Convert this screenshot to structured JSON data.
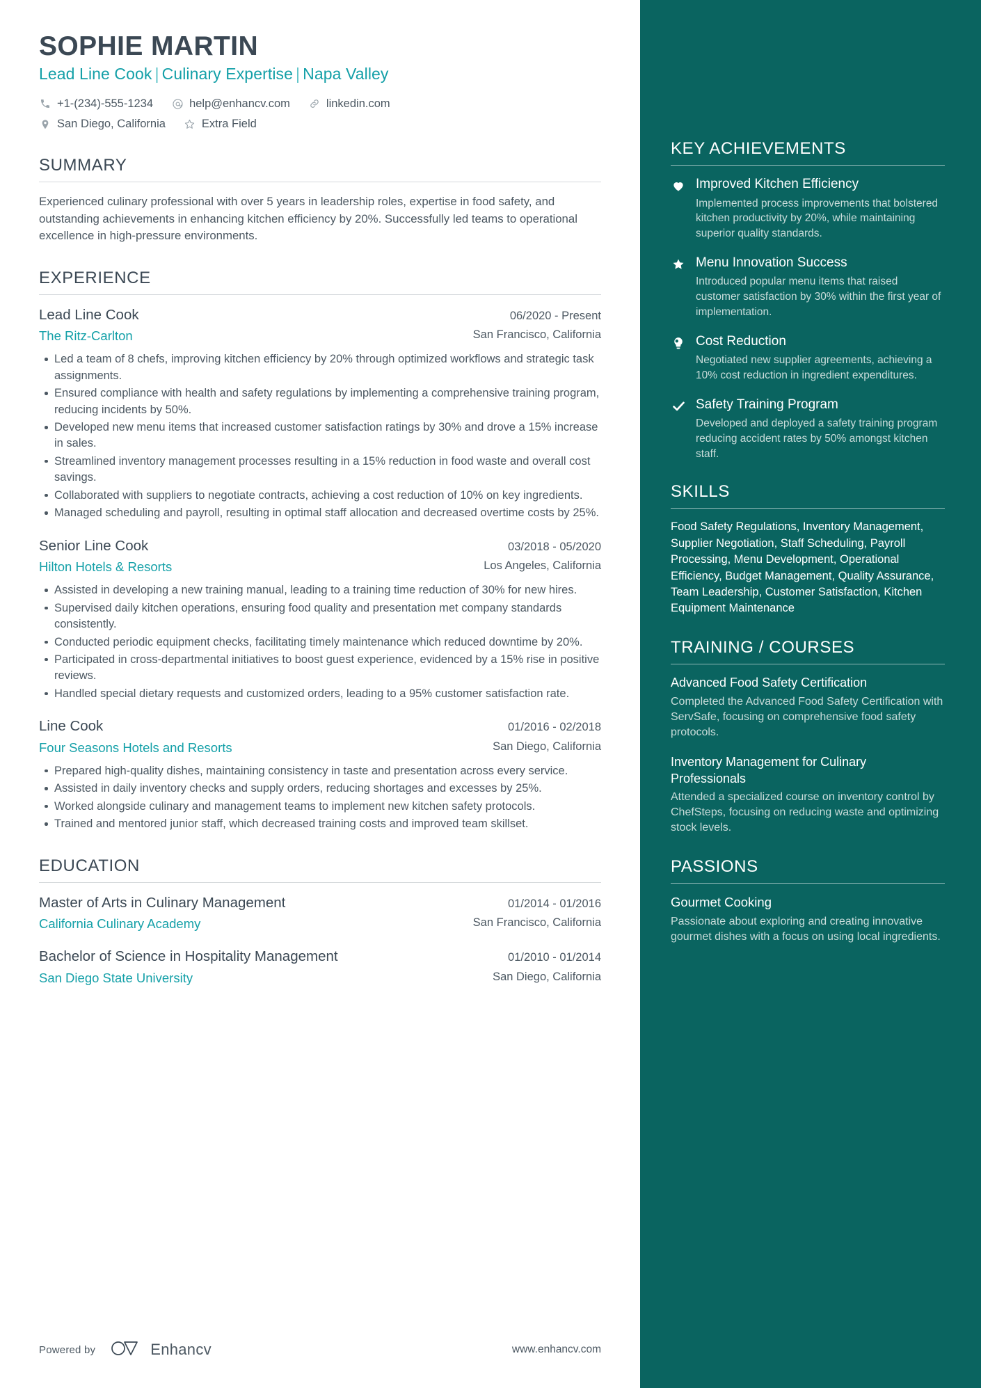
{
  "colors": {
    "accent_teal": "#14a0a8",
    "sidebar_bg": "#0a6460",
    "heading_dark": "#3b4854",
    "body_text": "#4c5862",
    "sidebar_muted": "#c9dcda"
  },
  "header": {
    "name": "SOPHIE MARTIN",
    "headline_parts": [
      "Lead Line Cook",
      "Culinary Expertise",
      "Napa Valley"
    ],
    "separator": "|",
    "contacts_row1": [
      {
        "icon": "phone-icon",
        "text": "+1-(234)-555-1234"
      },
      {
        "icon": "email-icon",
        "text": "help@enhancv.com"
      },
      {
        "icon": "link-icon",
        "text": "linkedin.com"
      }
    ],
    "contacts_row2": [
      {
        "icon": "location-pin-icon",
        "text": "San Diego, California"
      },
      {
        "icon": "star-outline-icon",
        "text": "Extra Field"
      }
    ]
  },
  "summary": {
    "title": "SUMMARY",
    "text": "Experienced culinary professional with over 5 years in leadership roles, expertise in food safety, and outstanding achievements in enhancing kitchen efficiency by 20%. Successfully led teams to operational excellence in high-pressure environments."
  },
  "experience": {
    "title": "EXPERIENCE",
    "entries": [
      {
        "role": "Lead Line Cook",
        "dates": "06/2020 - Present",
        "org": "The Ritz-Carlton",
        "location": "San Francisco, California",
        "bullets": [
          "Led a team of 8 chefs, improving kitchen efficiency by 20% through optimized workflows and strategic task assignments.",
          "Ensured compliance with health and safety regulations by implementing a comprehensive training program, reducing incidents by 50%.",
          "Developed new menu items that increased customer satisfaction ratings by 30% and drove a 15% increase in sales.",
          "Streamlined inventory management processes resulting in a 15% reduction in food waste and overall cost savings.",
          "Collaborated with suppliers to negotiate contracts, achieving a cost reduction of 10% on key ingredients.",
          "Managed scheduling and payroll, resulting in optimal staff allocation and decreased overtime costs by 25%."
        ]
      },
      {
        "role": "Senior Line Cook",
        "dates": "03/2018 - 05/2020",
        "org": "Hilton Hotels & Resorts",
        "location": "Los Angeles, California",
        "bullets": [
          "Assisted in developing a new training manual, leading to a training time reduction of 30% for new hires.",
          "Supervised daily kitchen operations, ensuring food quality and presentation met company standards consistently.",
          "Conducted periodic equipment checks, facilitating timely maintenance which reduced downtime by 20%.",
          "Participated in cross-departmental initiatives to boost guest experience, evidenced by a 15% rise in positive reviews.",
          "Handled special dietary requests and customized orders, leading to a 95% customer satisfaction rate."
        ]
      },
      {
        "role": "Line Cook",
        "dates": "01/2016 - 02/2018",
        "org": "Four Seasons Hotels and Resorts",
        "location": "San Diego, California",
        "bullets": [
          "Prepared high-quality dishes, maintaining consistency in taste and presentation across every service.",
          "Assisted in daily inventory checks and supply orders, reducing shortages and excesses by 25%.",
          "Worked alongside culinary and management teams to implement new kitchen safety protocols.",
          "Trained and mentored junior staff, which decreased training costs and improved team skillset."
        ]
      }
    ]
  },
  "education": {
    "title": "EDUCATION",
    "entries": [
      {
        "degree": "Master of Arts in Culinary Management",
        "dates": "01/2014 - 01/2016",
        "school": "California Culinary Academy",
        "location": "San Francisco, California"
      },
      {
        "degree": "Bachelor of Science in Hospitality Management",
        "dates": "01/2010 - 01/2014",
        "school": "San Diego State University",
        "location": "San Diego, California"
      }
    ]
  },
  "key_achievements": {
    "title": "KEY ACHIEVEMENTS",
    "items": [
      {
        "icon": "heart-icon",
        "title": "Improved Kitchen Efficiency",
        "desc": "Implemented process improvements that bolstered kitchen productivity by 20%, while maintaining superior quality standards."
      },
      {
        "icon": "star-icon",
        "title": "Menu Innovation Success",
        "desc": "Introduced popular menu items that raised customer satisfaction by 30% within the first year of implementation."
      },
      {
        "icon": "lightbulb-icon",
        "title": "Cost Reduction",
        "desc": "Negotiated new supplier agreements, achieving a 10% cost reduction in ingredient expenditures."
      },
      {
        "icon": "check-icon",
        "title": "Safety Training Program",
        "desc": "Developed and deployed a safety training program reducing accident rates by 50% amongst kitchen staff."
      }
    ]
  },
  "skills": {
    "title": "SKILLS",
    "text": "Food Safety Regulations, Inventory Management, Supplier Negotiation, Staff Scheduling, Payroll Processing, Menu Development, Operational Efficiency, Budget Management, Quality Assurance, Team Leadership, Customer Satisfaction, Kitchen Equipment Maintenance"
  },
  "training": {
    "title": "TRAINING / COURSES",
    "items": [
      {
        "name": "Advanced Food Safety Certification",
        "desc": "Completed the Advanced Food Safety Certification with ServSafe, focusing on comprehensive food safety protocols."
      },
      {
        "name": "Inventory Management for Culinary Professionals",
        "desc": "Attended a specialized course on inventory control by ChefSteps, focusing on reducing waste and optimizing stock levels."
      }
    ]
  },
  "passions": {
    "title": "PASSIONS",
    "items": [
      {
        "name": "Gourmet Cooking",
        "desc": "Passionate about exploring and creating innovative gourmet dishes with a focus on using local ingredients."
      }
    ]
  },
  "footer": {
    "powered_by": "Powered by",
    "brand": "Enhancv",
    "website": "www.enhancv.com"
  }
}
